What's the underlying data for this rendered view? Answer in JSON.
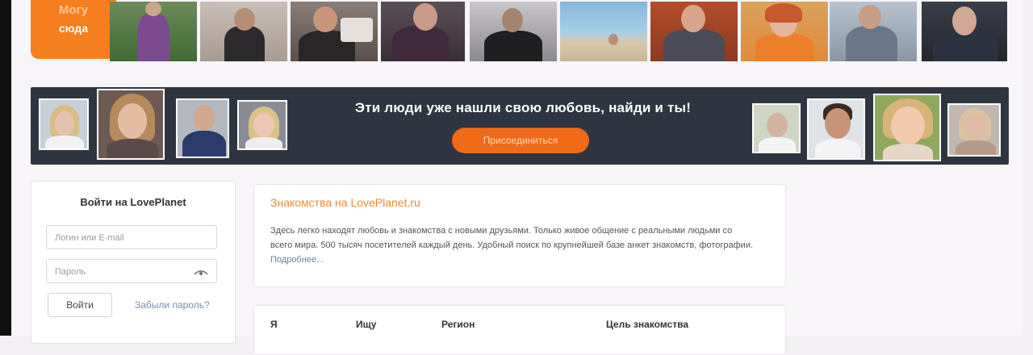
{
  "header": {
    "tile_line1": "Могу",
    "tile_line2": "сюда"
  },
  "banner": {
    "title": "Эти люди уже нашли свою любовь, найди и ты!",
    "button_label": "Присоединиться"
  },
  "login": {
    "title": "Войти на LovePlanet",
    "login_placeholder": "Логин или E-mail",
    "password_placeholder": "Пароль",
    "submit_label": "Войти",
    "forgot_label": "Забыли пароль?"
  },
  "info": {
    "title": "Знакомства на LovePlanet.ru",
    "text": "Здесь легко находят любовь и знакомства с новыми друзьями. Только живое общение с реальными людьми со всего мира. 500 тысяч посетителей каждый день. Удобный поиск по крупнейшей базе анкет знакомств, фотографии.",
    "more_label": "Подробнее..."
  },
  "search": {
    "labels": [
      "Я",
      "Ищу",
      "Регион",
      "Цель знакомства"
    ]
  },
  "colors": {
    "accent": "#f57f1e",
    "banner_bg": "#2f3540",
    "link": "#7c8fb0"
  }
}
